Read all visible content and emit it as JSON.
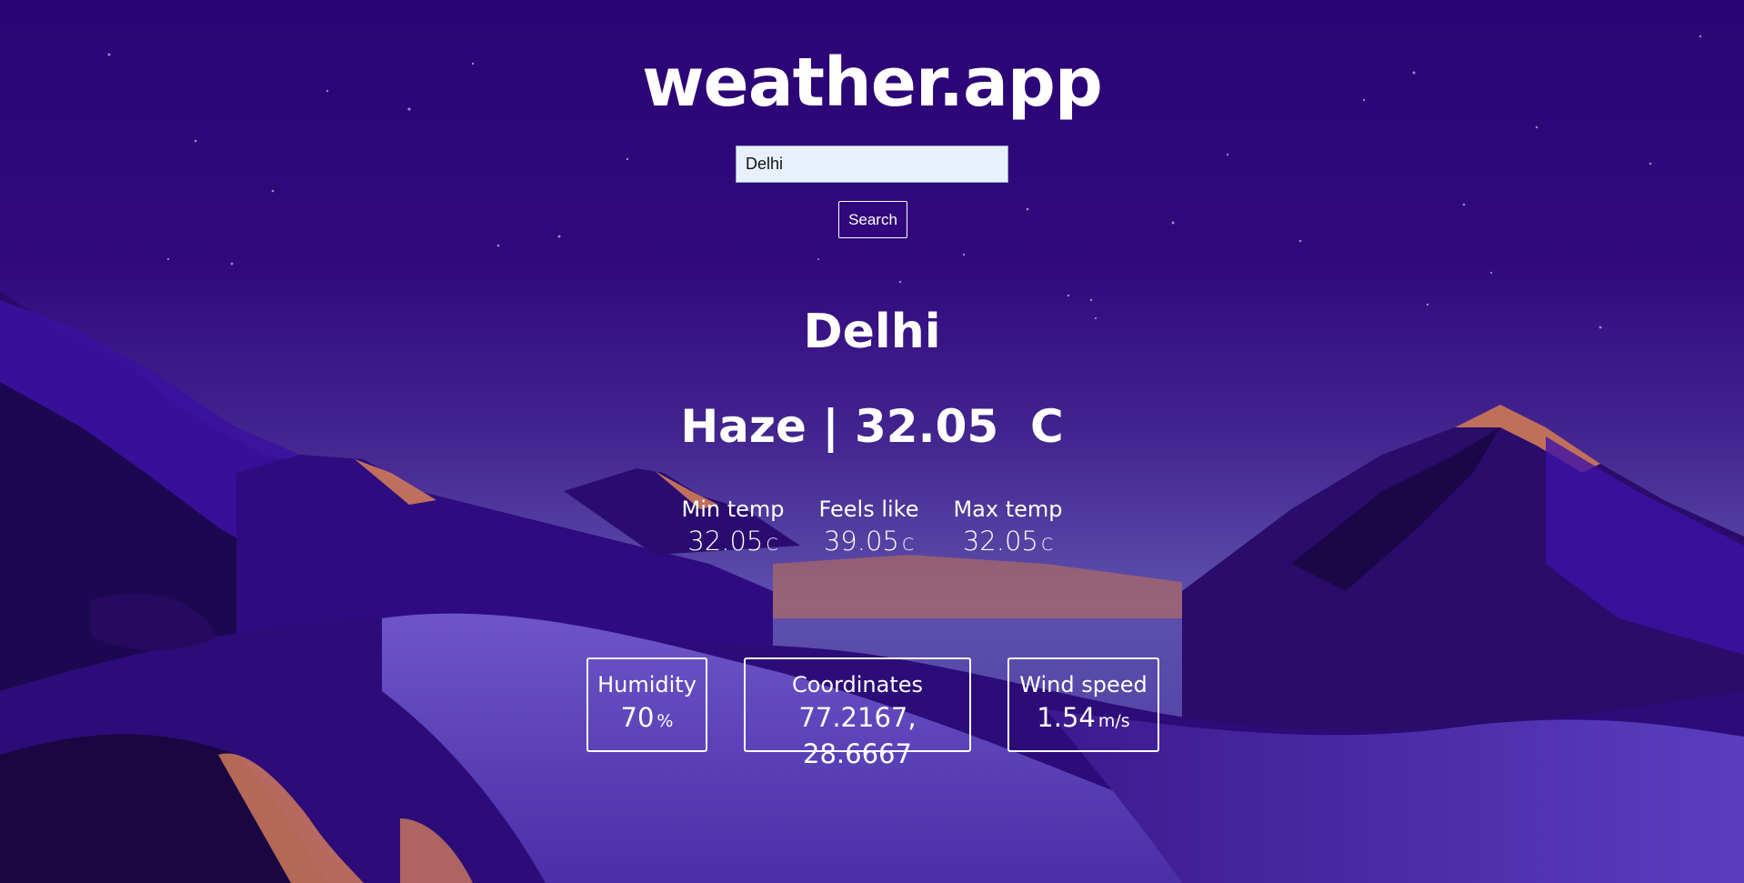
{
  "app": {
    "title": "weather.app"
  },
  "search": {
    "value": "Delhi",
    "button_label": "Search"
  },
  "weather": {
    "city": "Delhi",
    "condition_line": "Haze | 32.05  C",
    "min_temp": {
      "label": "Min temp",
      "value": "32.05",
      "unit": "C"
    },
    "feels_like": {
      "label": "Feels like",
      "value": "39.05",
      "unit": "C"
    },
    "max_temp": {
      "label": "Max temp",
      "value": "32.05",
      "unit": "C"
    }
  },
  "stats": {
    "humidity": {
      "label": "Humidity",
      "value": "70",
      "unit": "%"
    },
    "coordinates": {
      "label": "Coordinates",
      "value": "77.2167, 28.6667"
    },
    "wind_speed": {
      "label": "Wind speed",
      "value": "1.54",
      "unit": "m/s"
    }
  },
  "colors": {
    "sky_top": "#2a0574",
    "sky_horizon": "#5a4bb0",
    "mountain_dark": "#1a0640",
    "mountain_mid": "#3a0fa0",
    "dune_light": "#6a4fc8",
    "sunlit_rock": "#d07a5a",
    "text": "#ffffff",
    "input_bg": "#e8f0fe"
  }
}
